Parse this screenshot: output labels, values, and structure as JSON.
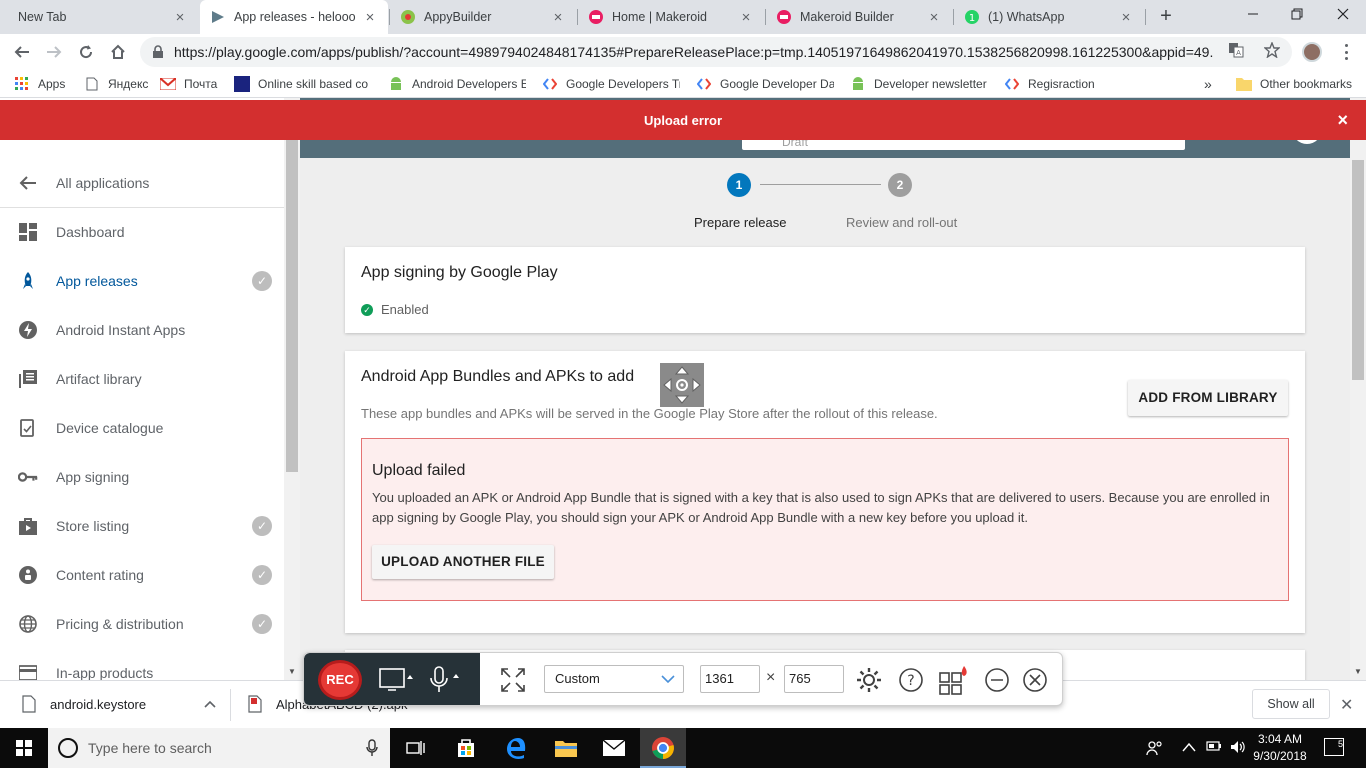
{
  "browser": {
    "tabs": [
      {
        "label": "New Tab",
        "icon": "none"
      },
      {
        "label": "App releases - helooo - ",
        "icon": "google-play-icon"
      },
      {
        "label": "AppyBuilder",
        "icon": "appybuilder-icon"
      },
      {
        "label": "Home | Makeroid",
        "icon": "makeroid-icon"
      },
      {
        "label": "Makeroid Builder",
        "icon": "makeroid-icon"
      },
      {
        "label": "(1) WhatsApp",
        "icon": "whatsapp-icon",
        "badge": "1"
      }
    ],
    "url": "https://play.google.com/apps/publish/?account=4989794024848174135#PrepareReleasePlace:p=tmp.14051971649862041970.1538256820998.161225300&appid=49..."
  },
  "bookmarks": [
    {
      "label": "Apps",
      "icon": "apps-grid-icon"
    },
    {
      "label": "Яндекс",
      "icon": "page-icon"
    },
    {
      "label": "Почта",
      "icon": "gmail-icon"
    },
    {
      "label": "Online skill based co",
      "icon": "site-icon"
    },
    {
      "label": "Android Developers E",
      "icon": "android-icon"
    },
    {
      "label": "Google Developers Tr",
      "icon": "google-developers-icon"
    },
    {
      "label": "Google Developer Da",
      "icon": "google-developers-icon"
    },
    {
      "label": "Developer newsletter",
      "icon": "android-icon"
    },
    {
      "label": "Regisraction",
      "icon": "google-developers-icon"
    },
    {
      "label": "Other bookmarks",
      "icon": "folder-icon"
    }
  ],
  "banner": {
    "text": "Upload error"
  },
  "sidebar": {
    "back": "All applications",
    "items": [
      {
        "label": "Dashboard",
        "icon": "dashboard-icon",
        "checked": false,
        "active": false
      },
      {
        "label": "App releases",
        "icon": "rocket-icon",
        "checked": true,
        "active": true
      },
      {
        "label": "Android Instant Apps",
        "icon": "instant-apps-icon",
        "checked": false,
        "active": false
      },
      {
        "label": "Artifact library",
        "icon": "library-icon",
        "checked": false,
        "active": false
      },
      {
        "label": "Device catalogue",
        "icon": "device-icon",
        "checked": false,
        "active": false
      },
      {
        "label": "App signing",
        "icon": "key-icon",
        "checked": false,
        "active": false
      },
      {
        "label": "Store listing",
        "icon": "store-icon",
        "checked": true,
        "active": false
      },
      {
        "label": "Content rating",
        "icon": "content-rating-icon",
        "checked": true,
        "active": false
      },
      {
        "label": "Pricing & distribution",
        "icon": "globe-icon",
        "checked": true,
        "active": false
      },
      {
        "label": "In-app products",
        "icon": "card-icon",
        "checked": false,
        "active": false
      }
    ]
  },
  "header": {
    "status": "Draft"
  },
  "stepper": {
    "steps": [
      {
        "number": "1",
        "label": "Prepare release",
        "active": true
      },
      {
        "number": "2",
        "label": "Review and roll-out",
        "active": false
      }
    ]
  },
  "signing_card": {
    "title": "App signing by Google Play",
    "status": "Enabled"
  },
  "bundles_card": {
    "title": "Android App Bundles and APKs to add",
    "subtitle": "These app bundles and APKs will be served in the Google Play Store after the rollout of this release.",
    "add_button": "ADD FROM LIBRARY",
    "error": {
      "title": "Upload failed",
      "message": "You uploaded an APK or Android App Bundle that is signed with a key that is also used to sign APKs that are delivered to users. Because you are enrolled in app signing by Google Play, you should sign your APK or Android App Bundle with a new key before you upload it.",
      "button": "UPLOAD ANOTHER FILE"
    }
  },
  "recorder": {
    "rec_label": "REC",
    "preset": "Custom",
    "width": "1361",
    "height": "765",
    "times": "×"
  },
  "downloads": {
    "items": [
      {
        "name": "android.keystore",
        "icon": "file-icon"
      },
      {
        "name": "AlphabetABCD (2).apk",
        "icon": "apk-file-icon"
      }
    ],
    "show_all": "Show all"
  },
  "taskbar": {
    "search_placeholder": "Type here to search",
    "time": "3:04 AM",
    "date": "9/30/2018",
    "notifications": "5"
  },
  "colors": {
    "error_red": "#d32f2f",
    "active_blue": "#01579b",
    "step_blue": "#0277bd",
    "header_gray": "#546e7a"
  }
}
